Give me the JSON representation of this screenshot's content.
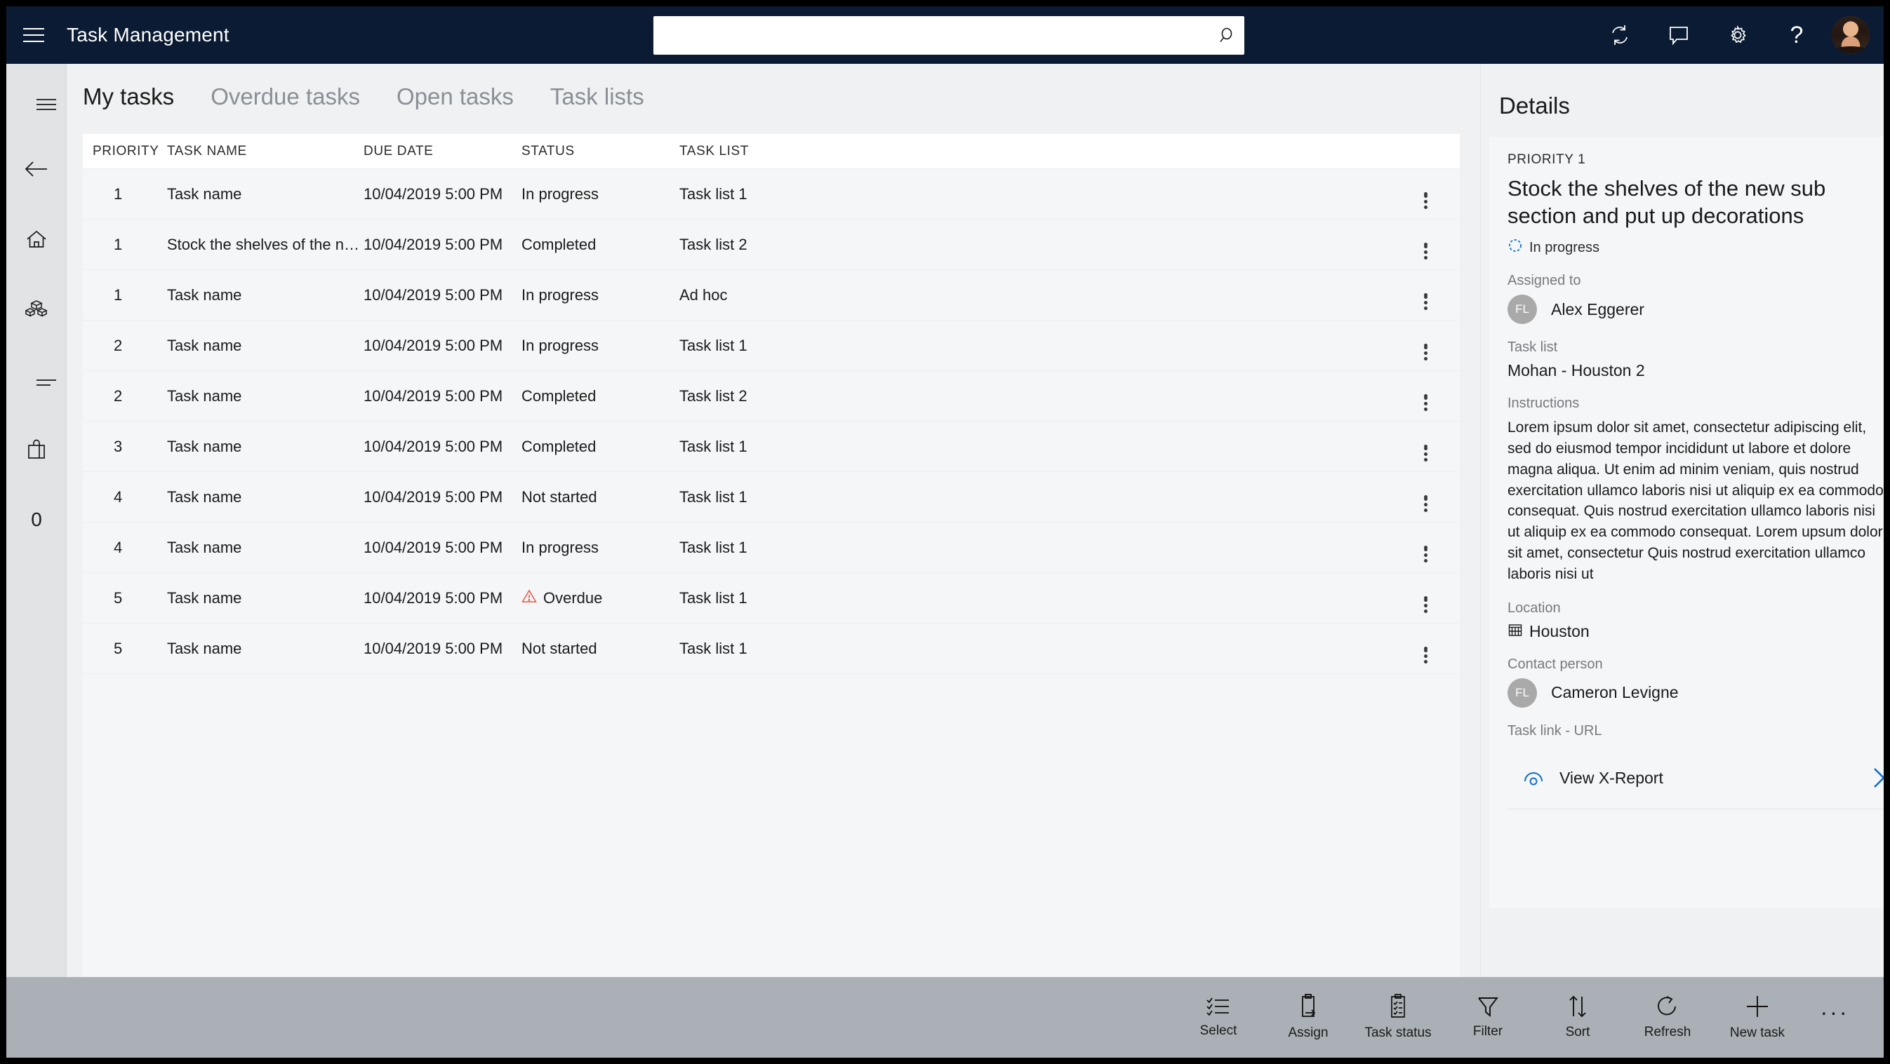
{
  "topbar": {
    "menu_icon": "hamburger-icon",
    "title": "Task Management",
    "search": {
      "value": "",
      "placeholder": ""
    },
    "icons": [
      {
        "name": "refresh-icon",
        "label": "Refresh"
      },
      {
        "name": "feedback-icon",
        "label": "Feedback"
      },
      {
        "name": "gear-icon",
        "label": "Settings"
      },
      {
        "name": "help-icon",
        "label": "Help"
      }
    ],
    "avatar": {
      "name": "user-avatar"
    }
  },
  "rail": {
    "items": [
      {
        "icon": "hamburger-icon",
        "label": "Menu"
      },
      {
        "icon": "back-arrow-icon",
        "label": "Back"
      },
      {
        "icon": "home-icon",
        "label": "Home"
      },
      {
        "icon": "products-icon",
        "label": "Products"
      },
      {
        "icon": "list-icon",
        "label": "Lists"
      },
      {
        "icon": "bag-icon",
        "label": "Bag"
      },
      {
        "icon": "zero-icon",
        "label": "0"
      }
    ]
  },
  "tabs": [
    {
      "label": "My tasks",
      "active": true
    },
    {
      "label": "Overdue tasks",
      "active": false
    },
    {
      "label": "Open tasks",
      "active": false
    },
    {
      "label": "Task lists",
      "active": false
    }
  ],
  "table": {
    "columns": [
      "PRIORITY",
      "TASK NAME",
      "DUE DATE",
      "STATUS",
      "TASK LIST"
    ],
    "rows": [
      {
        "priority": "1",
        "name": "Task name",
        "due": "10/04/2019 5:00 PM",
        "status": "In progress",
        "overdue": false,
        "list": "Task list 1"
      },
      {
        "priority": "1",
        "name": "Stock the shelves of the new sub section...",
        "due": "10/04/2019 5:00 PM",
        "status": "Completed",
        "overdue": false,
        "list": "Task list 2"
      },
      {
        "priority": "1",
        "name": "Task name",
        "due": "10/04/2019 5:00 PM",
        "status": "In progress",
        "overdue": false,
        "list": "Ad hoc"
      },
      {
        "priority": "2",
        "name": "Task name",
        "due": "10/04/2019 5:00 PM",
        "status": "In progress",
        "overdue": false,
        "list": "Task list 1"
      },
      {
        "priority": "2",
        "name": "Task name",
        "due": "10/04/2019 5:00 PM",
        "status": "Completed",
        "overdue": false,
        "list": "Task list 2"
      },
      {
        "priority": "3",
        "name": "Task name",
        "due": "10/04/2019 5:00 PM",
        "status": "Completed",
        "overdue": false,
        "list": "Task list 1"
      },
      {
        "priority": "4",
        "name": "Task name",
        "due": "10/04/2019 5:00 PM",
        "status": "Not started",
        "overdue": false,
        "list": "Task list 1"
      },
      {
        "priority": "4",
        "name": "Task name",
        "due": "10/04/2019 5:00 PM",
        "status": "In progress",
        "overdue": false,
        "list": "Task list 1"
      },
      {
        "priority": "5",
        "name": "Task name",
        "due": "10/04/2019 5:00 PM",
        "status": "Overdue",
        "overdue": true,
        "list": "Task list 1"
      },
      {
        "priority": "5",
        "name": "Task name",
        "due": "10/04/2019 5:00 PM",
        "status": "Not started",
        "overdue": false,
        "list": "Task list 1"
      }
    ]
  },
  "details": {
    "title": "Details",
    "expand_icon": "expand-panel-icon",
    "priority_label": "PRIORITY 1",
    "task_title": "Stock the shelves of the new sub section and put up decorations",
    "status": "In progress",
    "status_icon": "in-progress-icon",
    "assigned_to_label": "Assigned to",
    "assigned_to_initials": "FL",
    "assigned_to_name": "Alex Eggerer",
    "task_list_label": "Task list",
    "task_list_value": "Mohan - Houston 2",
    "instructions_label": "Instructions",
    "instructions_text": "Lorem ipsum dolor sit amet, consectetur adipiscing elit, sed do eiusmod tempor incididunt ut labore et dolore magna aliqua. Ut enim ad minim veniam, quis nostrud exercitation ullamco laboris nisi ut aliquip ex ea commodo consequat. Quis nostrud exercitation ullamco laboris nisi ut aliquip ex ea commodo consequat. Lorem upsum dolor sit amet, consectetur Quis nostrud exercitation ullamco laboris nisi ut",
    "location_label": "Location",
    "location_value": "Houston",
    "location_icon": "building-icon",
    "contact_label": "Contact person",
    "contact_initials": "FL",
    "contact_name": "Cameron Levigne",
    "task_link_label": "Task link - URL",
    "task_link_text": "View X-Report",
    "task_link_icon": "report-icon",
    "task_link_chevron": "chevron-right-icon"
  },
  "commandbar": {
    "items": [
      {
        "label": "Select",
        "icon": "select-list-icon"
      },
      {
        "label": "Assign",
        "icon": "assign-clipboard-icon"
      },
      {
        "label": "Task status",
        "icon": "task-status-clipboard-icon"
      },
      {
        "label": "Filter",
        "icon": "filter-funnel-icon"
      },
      {
        "label": "Sort",
        "icon": "sort-arrows-icon"
      },
      {
        "label": "Refresh",
        "icon": "refresh-circle-icon"
      },
      {
        "label": "New task",
        "icon": "plus-icon"
      }
    ],
    "overflow": "···"
  },
  "colors": {
    "topbar_bg": "#0b1b33",
    "accent_blue": "#1270c6",
    "overdue_red": "#e8563a",
    "cmdbar_bg": "#aab0b5",
    "panel_bg": "#f4f6f8",
    "page_bg": "#eff1f3"
  }
}
